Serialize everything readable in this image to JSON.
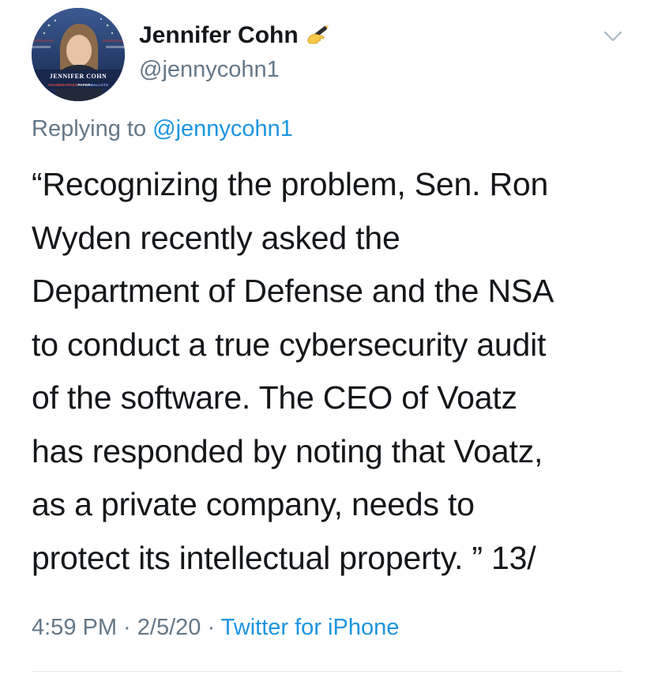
{
  "author": {
    "display_name": "Jennifer Cohn",
    "name_emoji": "writing-hand-emoji",
    "handle": "@jennycohn1",
    "avatar_caption": "JENNIFER COHN",
    "avatar_tag_parts": [
      "#HANDMARKED",
      "PAPER",
      "BALLOTS"
    ]
  },
  "reply": {
    "prefix": "Replying to ",
    "handle": "@jennycohn1"
  },
  "tweet": {
    "lines": [
      "“Recognizing the problem, Sen. Ron",
      "Wyden recently asked the",
      "Department of Defense and the NSA",
      "to conduct a true cybersecurity audit",
      "of the software. The CEO of Voatz",
      "has responded by noting that Voatz,",
      "as a private company, needs to",
      "protect its intellectual property. ” 13/"
    ]
  },
  "meta": {
    "time": "4:59 PM",
    "separator": " · ",
    "date": "2/5/20",
    "source": "Twitter for iPhone"
  },
  "colors": {
    "text": "#14171a",
    "secondary": "#657786",
    "link": "#1b95e0",
    "divider": "#e1e8ed"
  },
  "icons": {
    "menu": "chevron-down-icon"
  }
}
